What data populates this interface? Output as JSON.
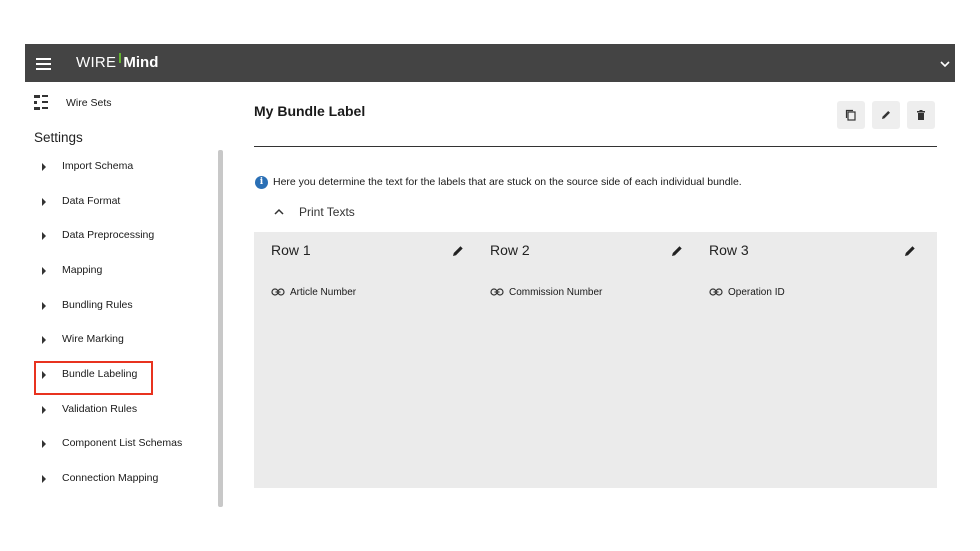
{
  "app": {
    "logo_part1": "WIRE",
    "logo_part2": "Mind",
    "accent_color": "#62b32f",
    "topbar_color": "#444444"
  },
  "sidebar": {
    "wire_sets_label": "Wire Sets",
    "settings_title": "Settings",
    "items": [
      {
        "label": "Import Schema"
      },
      {
        "label": "Data Format"
      },
      {
        "label": "Data Preprocessing"
      },
      {
        "label": "Mapping"
      },
      {
        "label": "Bundling Rules"
      },
      {
        "label": "Wire Marking"
      },
      {
        "label": "Bundle Labeling"
      },
      {
        "label": "Validation Rules"
      },
      {
        "label": "Component List Schemas"
      },
      {
        "label": "Connection Mapping"
      }
    ],
    "highlighted_item": "Bundle Labeling",
    "highlight_color": "#e8321f"
  },
  "main": {
    "title": "My Bundle Label",
    "actions": [
      {
        "icon": "copy-icon"
      },
      {
        "icon": "pencil-icon"
      },
      {
        "icon": "trash-icon"
      }
    ],
    "info_text": "Here you determine the text for the labels that are stuck on the source side of each individual bundle.",
    "print_texts_label": "Print Texts",
    "rows": [
      {
        "title": "Row 1",
        "field": "Article Number"
      },
      {
        "title": "Row 2",
        "field": "Commission Number"
      },
      {
        "title": "Row 3",
        "field": "Operation ID"
      }
    ]
  }
}
